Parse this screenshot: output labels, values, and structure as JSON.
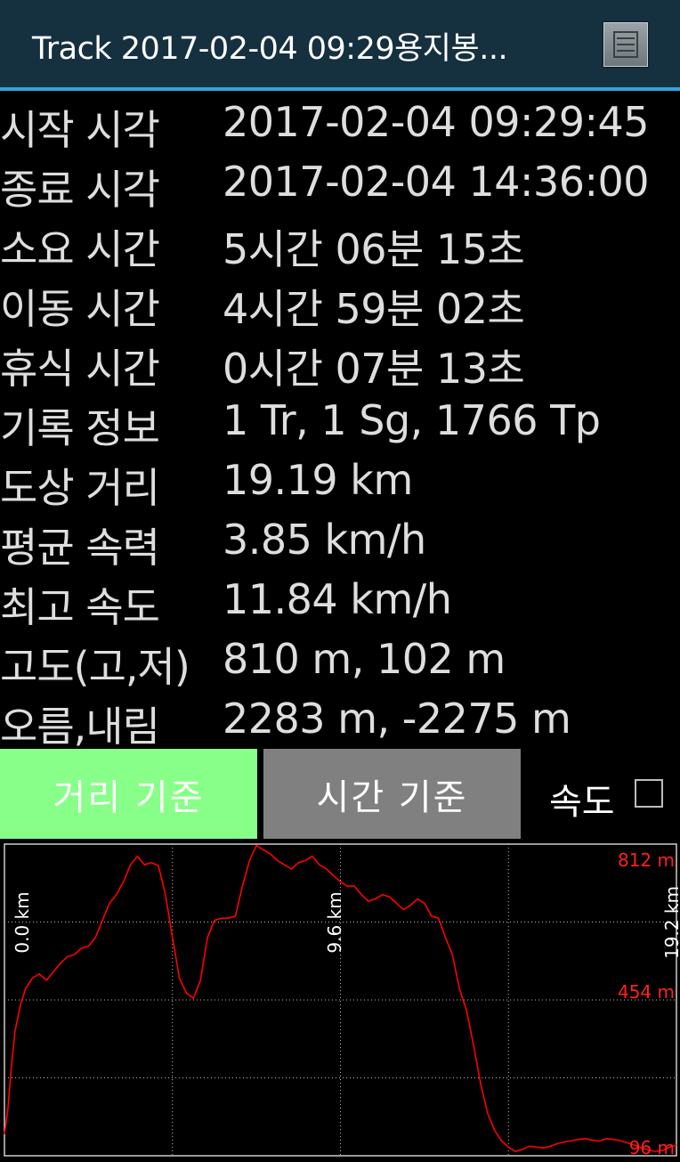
{
  "titlebar": {
    "title": "Track 2017-02-04 09:29용지봉...",
    "menu_icon": "list-menu-icon"
  },
  "info": [
    {
      "label": "시작 시각",
      "value": "2017-02-04 09:29:45"
    },
    {
      "label": "종료 시각",
      "value": "2017-02-04 14:36:00"
    },
    {
      "label": "소요 시간",
      "value": "5시간 06분 15초"
    },
    {
      "label": "이동 시간",
      "value": "4시간 59분 02초"
    },
    {
      "label": "휴식 시간",
      "value": "0시간 07분 13초"
    },
    {
      "label": "기록 정보",
      "value": "1 Tr, 1 Sg, 1766 Tp"
    },
    {
      "label": "도상 거리",
      "value": "19.19 km"
    },
    {
      "label": "평균 속력",
      "value": "3.85 km/h"
    },
    {
      "label": "최고 속도",
      "value": "11.84 km/h"
    },
    {
      "label": "고도(고,저)",
      "value": "810 m, 102 m"
    },
    {
      "label": "오름,내림",
      "value": "2283 m, -2275 m"
    }
  ],
  "buttons": {
    "distance_basis": "거리 기준",
    "time_basis": "시간 기준",
    "speed_label": "속도",
    "speed_checked": false
  },
  "colors": {
    "active_button": "#88ff88",
    "inactive_button": "#808080",
    "line": "#ff0000",
    "titlebar": "#15303f",
    "titlebar_accent": "#2ea7dc"
  },
  "chart_data": {
    "type": "line",
    "xlabel": "",
    "ylabel": "",
    "x_ticks": [
      "0.0 km",
      "9.6 km",
      "19.2 km"
    ],
    "y_ticks": [
      "812 m",
      "454 m",
      "96 m"
    ],
    "xlim": [
      0,
      19.2
    ],
    "ylim": [
      96,
      812
    ],
    "grid": true,
    "series": [
      {
        "x": [
          0.0,
          0.1,
          0.2,
          0.3,
          0.45,
          0.6,
          0.8,
          1.0,
          1.2,
          1.4,
          1.6,
          1.8,
          2.0,
          2.2,
          2.4,
          2.6,
          2.8,
          3.0,
          3.2,
          3.4,
          3.6,
          3.8,
          4.0,
          4.2,
          4.4,
          4.6,
          4.8,
          5.0,
          5.2,
          5.4,
          5.6,
          5.8,
          6.0,
          6.2,
          6.4,
          6.6,
          6.8,
          7.0,
          7.2,
          7.4,
          7.6,
          7.8,
          8.0,
          8.2,
          8.4,
          8.6,
          8.8,
          9.0,
          9.2,
          9.4,
          9.6,
          9.8,
          10.0,
          10.2,
          10.4,
          10.6,
          10.8,
          11.0,
          11.2,
          11.4,
          11.6,
          11.8,
          12.0,
          12.2,
          12.4,
          12.6,
          12.8,
          13.0,
          13.2,
          13.4,
          13.6,
          13.8,
          14.0,
          14.2,
          14.4,
          14.6,
          14.8,
          15.0,
          15.2,
          15.4,
          15.6,
          15.8,
          16.0,
          16.2,
          16.4,
          16.6,
          16.8,
          17.0,
          17.2,
          17.4,
          17.6,
          17.8,
          18.0,
          18.2,
          18.4,
          18.6,
          18.8,
          19.0,
          19.2
        ],
        "y": [
          140,
          200,
          300,
          380,
          440,
          480,
          505,
          515,
          500,
          520,
          540,
          555,
          560,
          575,
          580,
          600,
          640,
          680,
          700,
          730,
          770,
          790,
          770,
          775,
          768,
          700,
          600,
          505,
          470,
          458,
          500,
          600,
          640,
          645,
          645,
          650,
          720,
          780,
          815,
          805,
          795,
          780,
          770,
          760,
          775,
          780,
          790,
          770,
          760,
          745,
          730,
          720,
          720,
          700,
          685,
          690,
          700,
          695,
          680,
          665,
          675,
          690,
          680,
          650,
          645,
          600,
          560,
          480,
          430,
          350,
          260,
          190,
          150,
          125,
          110,
          100,
          105,
          112,
          110,
          108,
          112,
          118,
          122,
          125,
          128,
          130,
          126,
          124,
          130,
          128,
          125,
          120,
          115,
          108,
          103,
          100,
          102,
          110,
          115
        ]
      }
    ]
  }
}
